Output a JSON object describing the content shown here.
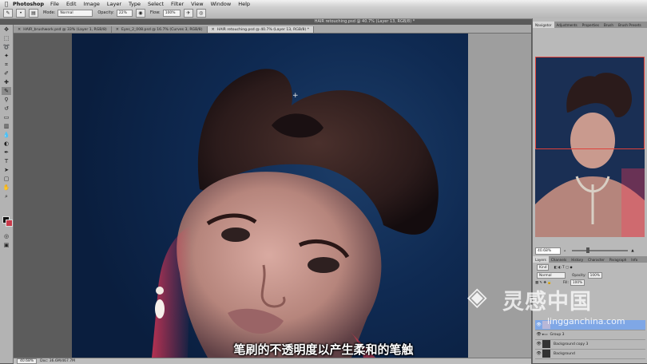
{
  "menubar": {
    "app": "Photoshop",
    "items": [
      "File",
      "Edit",
      "Image",
      "Layer",
      "Type",
      "Select",
      "Filter",
      "View",
      "Window",
      "Help"
    ]
  },
  "options": {
    "mode_label": "Mode:",
    "mode_value": "Normal",
    "opacity_label": "Opacity:",
    "opacity_value": "22%",
    "flow_label": "Flow:",
    "flow_value": "100%"
  },
  "window_title": "HAIR retouching.psd @ 40.7% (Layer 13, RGB/8) *",
  "tabs": [
    "HAIR_brushwork.psd @ 33% (Layer 1, RGB/8)",
    "Eyes_2_008.psd @ 16.7% (Curves 3, RGB/8)",
    "HAIR retouching.psd @ 40.7% (Layer 13, RGB/8) *"
  ],
  "status": {
    "zoom": "40.68%",
    "doc": "Doc: 36.6M/467.7M"
  },
  "panel": {
    "top_tabs": [
      "Navigator",
      "Adjustments",
      "Properties",
      "Brush",
      "Brush Presets"
    ],
    "zoom": "40.68%",
    "layer_tabs": [
      "Layers",
      "Channels",
      "History",
      "Character",
      "Paragraph",
      "Info"
    ],
    "kind_label": "Kind",
    "blend": "Normal",
    "opacity_label": "Opacity:",
    "opacity": "100%",
    "fill_label": "Fill:",
    "fill": "100%",
    "layers": [
      {
        "name": "Group 3"
      },
      {
        "name": "Background copy 3"
      },
      {
        "name": "Background"
      }
    ]
  },
  "subtitle": "笔刷的不透明度以产生柔和的笔触",
  "watermark": {
    "zh": "灵感中国",
    "url": "lingganchina.com"
  }
}
